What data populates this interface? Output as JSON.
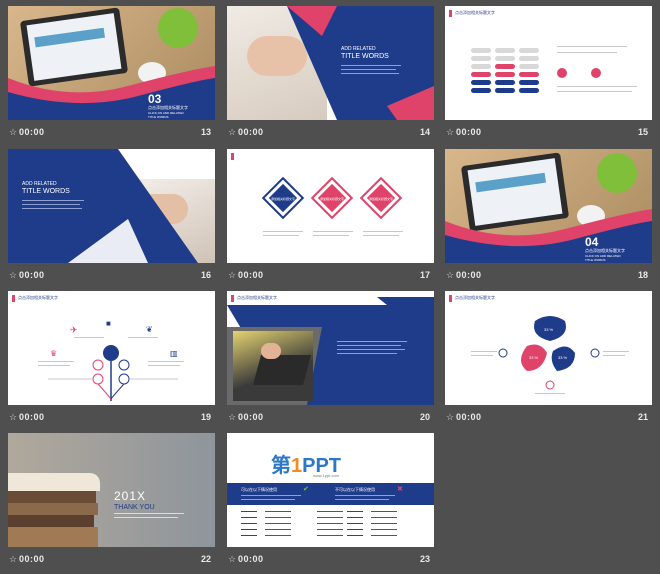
{
  "slides": [
    {
      "num": "13",
      "time": "00:00",
      "big": "03",
      "cn": "点击添加相关标题文字",
      "sub1": "CLICK ON ADD RELATED",
      "sub2": "TITLE WORDS"
    },
    {
      "num": "14",
      "time": "00:00",
      "top": "ADD RELATED",
      "title": "TITLE WORDS"
    },
    {
      "num": "15",
      "time": "00:00",
      "tag": "点击添加相关标题文字"
    },
    {
      "num": "16",
      "time": "00:00",
      "tag": "点击添加相关标题文字",
      "top": "ADD RELATED",
      "title": "TITLE WORDS"
    },
    {
      "num": "17",
      "time": "00:00",
      "d1": "添加相关标题文字",
      "d2": "添加相关标题文字",
      "d3": "添加相关标题文字"
    },
    {
      "num": "18",
      "time": "00:00",
      "big": "04",
      "cn": "点击添加相关标题文字",
      "sub1": "CLICK ON ADD RELATED",
      "sub2": "TITLE WORDS"
    },
    {
      "num": "19",
      "time": "00:00",
      "tag": "点击添加相关标题文字"
    },
    {
      "num": "20",
      "time": "00:00",
      "tag": "点击添加相关标题文字"
    },
    {
      "num": "21",
      "time": "00:00",
      "tag": "点击添加相关标题文字",
      "p1": "33 %",
      "p2": "33 %",
      "p3": "33 %"
    },
    {
      "num": "22",
      "time": "00:00",
      "year": "201X",
      "thanks": "THANK YOU"
    },
    {
      "num": "23",
      "time": "00:00",
      "logo_a": "第",
      "logo_b": "1",
      "logo_c": "PPT",
      "site": "www.1ppt.com",
      "left_title": "可以在以下情况使用",
      "right_title": "不可以在以下情况使用"
    }
  ],
  "colors": {
    "navy": "#1f3c8a",
    "pink": "#e0436a",
    "background": "#4f4f4f"
  }
}
